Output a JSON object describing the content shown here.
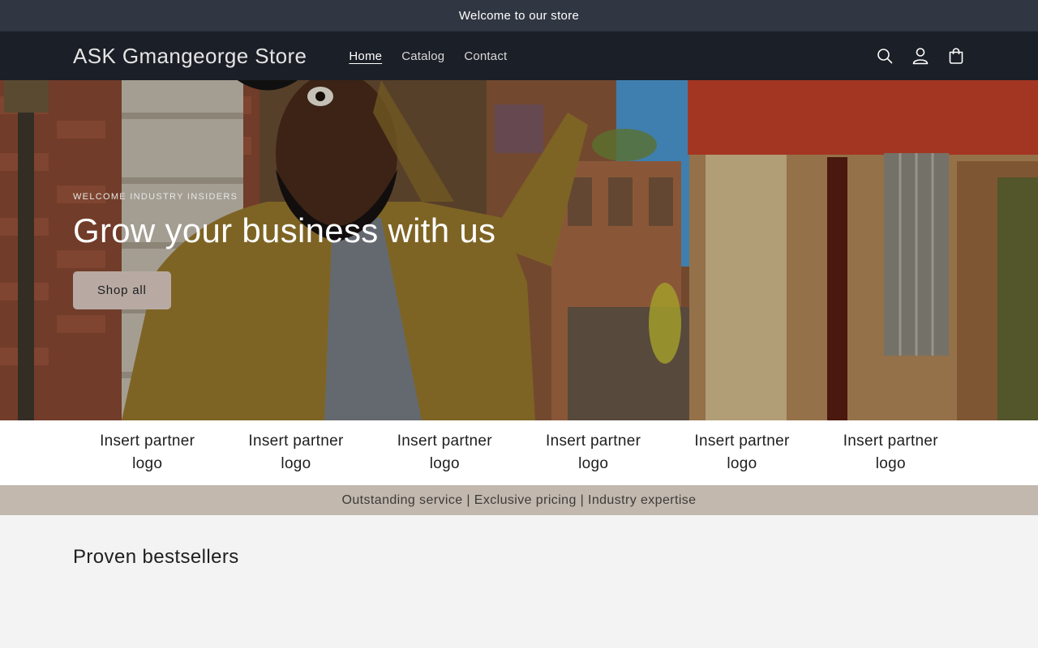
{
  "announcement": {
    "text": "Welcome to our store"
  },
  "header": {
    "logo": "ASK Gmangeorge Store",
    "nav": [
      {
        "label": "Home",
        "active": true
      },
      {
        "label": "Catalog",
        "active": false
      },
      {
        "label": "Contact",
        "active": false
      }
    ],
    "icons": [
      "search-icon",
      "account-icon",
      "cart-icon"
    ]
  },
  "hero": {
    "eyebrow": "WELCOME INDUSTRY INSIDERS",
    "title": "Grow your business with us",
    "button_label": "Shop all"
  },
  "partners": [
    {
      "line1": "Insert partner",
      "line2": "logo"
    },
    {
      "line1": "Insert partner",
      "line2": "logo"
    },
    {
      "line1": "Insert partner",
      "line2": "logo"
    },
    {
      "line1": "Insert partner",
      "line2": "logo"
    },
    {
      "line1": "Insert partner",
      "line2": "logo"
    },
    {
      "line1": "Insert partner",
      "line2": "logo"
    }
  ],
  "usp": {
    "text": "Outstanding service | Exclusive pricing | Industry expertise"
  },
  "bestsellers": {
    "heading": "Proven bestsellers"
  },
  "colors": {
    "announcement_bg": "#313742",
    "header_bg": "#1b1f27",
    "button_bg": "#b8aaa3",
    "usp_bg": "#c2b8ad"
  }
}
